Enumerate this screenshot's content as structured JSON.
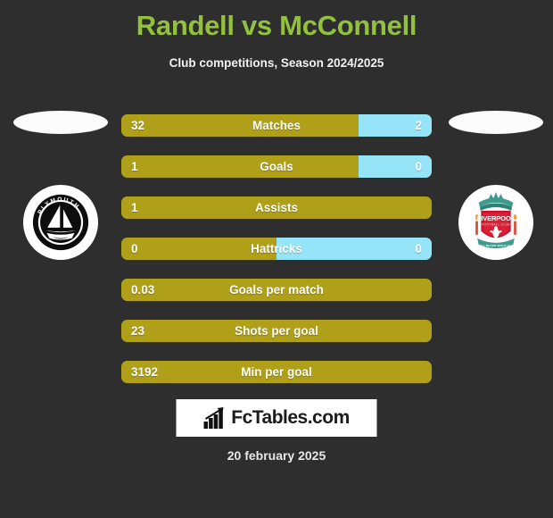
{
  "header": {
    "title": "Randell vs McConnell",
    "subtitle": "Club competitions, Season 2024/2025",
    "title_color": "#92c13d",
    "background_color": "#2e2e2e"
  },
  "colors": {
    "left_bar": "#b09f18",
    "right_bar": "#95e4f8",
    "text": "#ffffff"
  },
  "players": {
    "left": {
      "name": "Randell",
      "club_badge": "plymouth-argyle-badge",
      "badge_text": "PLYMOUTH"
    },
    "right": {
      "name": "McConnell",
      "club_badge": "liverpool-badge",
      "badge_text": "LIVERPOOL",
      "badge_subtext": "FOOTBALL CLUB",
      "badge_motto": "YOU'LL NEVER WALK ALONE"
    }
  },
  "stats": [
    {
      "label": "Matches",
      "left": "32",
      "right": "2",
      "left_pct": 76.4
    },
    {
      "label": "Goals",
      "left": "1",
      "right": "0",
      "left_pct": 76.4
    },
    {
      "label": "Assists",
      "left": "1",
      "right": "",
      "left_pct": 100
    },
    {
      "label": "Hattricks",
      "left": "0",
      "right": "0",
      "left_pct": 50
    },
    {
      "label": "Goals per match",
      "left": "0.03",
      "right": "",
      "left_pct": 100
    },
    {
      "label": "Shots per goal",
      "left": "23",
      "right": "",
      "left_pct": 100
    },
    {
      "label": "Min per goal",
      "left": "3192",
      "right": "",
      "left_pct": 100
    }
  ],
  "footer": {
    "logo_text": "FcTables.com",
    "logo_icon": "bar-chart-icon",
    "date": "20 february 2025"
  }
}
